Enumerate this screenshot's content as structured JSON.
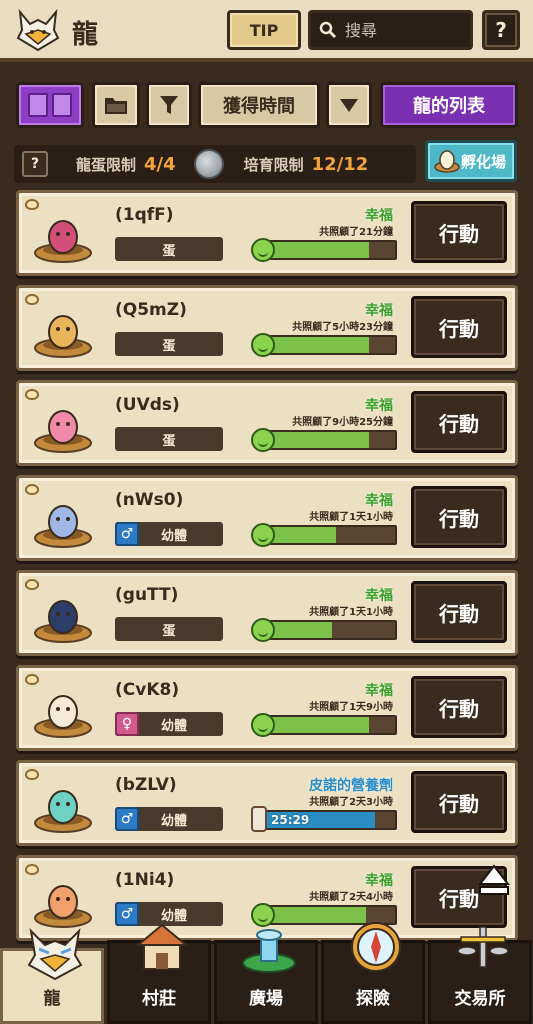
{
  "header": {
    "title": "龍",
    "tip_label": "TIP",
    "search_placeholder": "搜尋",
    "help_label": "?"
  },
  "filters": {
    "sort_label": "獲得時間",
    "list_label": "龍的列表"
  },
  "limits": {
    "help_label": "?",
    "egg_label": "龍蛋限制",
    "egg_value": "4/4",
    "breed_label": "培育限制",
    "breed_value": "12/12",
    "hatch_label": "孵化場"
  },
  "dragons": [
    {
      "name": "(1qfF)",
      "stage": "蛋",
      "gender": "",
      "mood": "幸福",
      "care": "共照顧了21分鐘",
      "bar": 0.8,
      "timer": "",
      "action": "行動"
    },
    {
      "name": "(Q5mZ)",
      "stage": "蛋",
      "gender": "",
      "mood": "幸福",
      "care": "共照顧了5小時23分鐘",
      "bar": 0.8,
      "timer": "",
      "action": "行動"
    },
    {
      "name": "(UVds)",
      "stage": "蛋",
      "gender": "",
      "mood": "幸福",
      "care": "共照顧了9小時25分鐘",
      "bar": 0.8,
      "timer": "",
      "action": "行動"
    },
    {
      "name": "(nWs0)",
      "stage": "幼體",
      "gender": "male",
      "mood": "幸福",
      "care": "共照顧了1天1小時",
      "bar": 0.55,
      "timer": "",
      "action": "行動"
    },
    {
      "name": "(guTT)",
      "stage": "蛋",
      "gender": "",
      "mood": "幸福",
      "care": "共照顧了1天1小時",
      "bar": 0.52,
      "timer": "",
      "action": "行動"
    },
    {
      "name": "(CvK8)",
      "stage": "幼體",
      "gender": "female",
      "mood": "幸福",
      "care": "共照顧了1天9小時",
      "bar": 0.8,
      "timer": "",
      "action": "行動"
    },
    {
      "name": "(bZLV)",
      "stage": "幼體",
      "gender": "male",
      "mood": "皮諾的營養劑",
      "care": "共照顧了2天3小時",
      "bar": 0.85,
      "timer": "25:29",
      "action": "行動"
    },
    {
      "name": "(1Ni4)",
      "stage": "幼體",
      "gender": "male",
      "mood": "幸福",
      "care": "共照顧了2天4小時",
      "bar": 0.78,
      "timer": "",
      "action": "行動"
    }
  ],
  "nav": [
    {
      "label": "龍",
      "active": true
    },
    {
      "label": "村莊",
      "active": false
    },
    {
      "label": "廣場",
      "active": false
    },
    {
      "label": "探險",
      "active": false
    },
    {
      "label": "交易所",
      "active": false
    }
  ],
  "colors": {
    "accent_purple": "#7a2fb0",
    "mood_green": "#3c9f2a",
    "limit_orange": "#f2a33a",
    "hatch_teal": "#4fb8c6"
  }
}
